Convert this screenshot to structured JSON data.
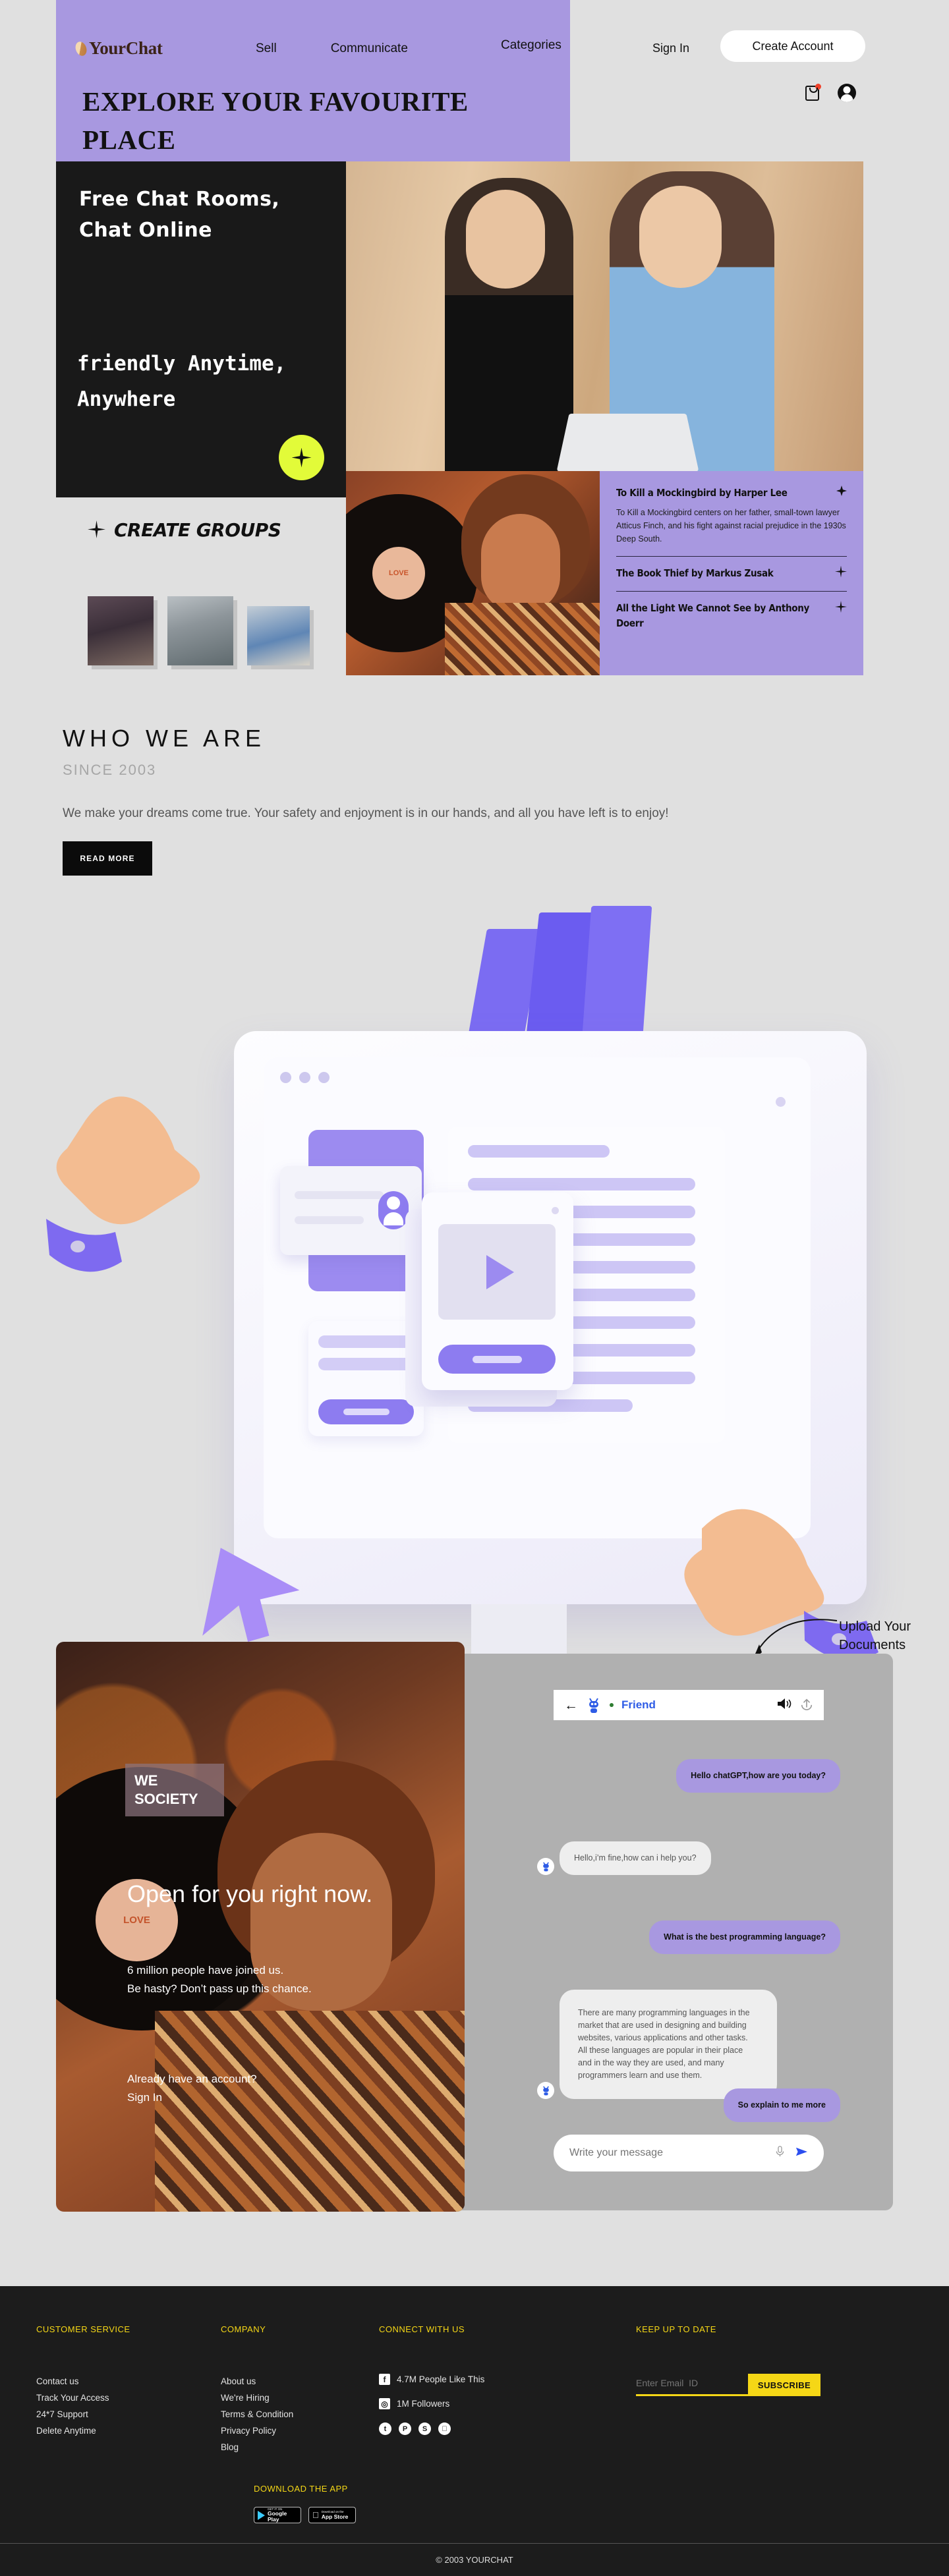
{
  "brand": {
    "name": "YourChat"
  },
  "nav": {
    "links": [
      "Sell",
      "Communicate",
      "Categories"
    ],
    "sign_in": "Sign In",
    "create_account": "Create Account",
    "icons": [
      "shopping-bag-icon",
      "user-avatar-icon"
    ]
  },
  "hero_banner": {
    "title": "EXPLORE YOUR FAVOURITE PLACE"
  },
  "hero": {
    "headline": "Free Chat Rooms, Chat Online",
    "subline": "friendly Anytime, Anywhere",
    "badge_icon": "four-point-star-icon"
  },
  "books": {
    "items": [
      {
        "title": "To Kill a Mockingbird by Harper Lee",
        "desc": "To Kill a Mockingbird centers on her father, small-town lawyer Atticus Finch, and his fight against racial prejudice in the 1930s Deep South.",
        "icon": "four-point-star-icon"
      },
      {
        "title": "The Book Thief by Markus Zusak",
        "desc": "",
        "icon": "four-point-star-icon"
      },
      {
        "title": "All the Light We Cannot See by Anthony Doerr",
        "desc": "",
        "icon": "four-point-star-icon"
      }
    ]
  },
  "groups": {
    "title": "CREATE GROUPS",
    "icon": "four-point-star-icon"
  },
  "who_we_are": {
    "title": "WHO WE ARE",
    "since": "SINCE 2003",
    "body": "We make your dreams come true. Your safety and enjoyment is in our hands, and all you have left is to enjoy!",
    "cta": "READ MORE"
  },
  "promo": {
    "tag": "WE SOCIETY",
    "headline": "Open for you right now.",
    "sub_line1": "6 million people have joined us.",
    "sub_line2": "Be hasty? Don’t pass up this chance.",
    "account_line1": "Already have an account?",
    "account_line2": "Sign In"
  },
  "chat": {
    "contact_name": "Friend",
    "back_icon": "arrow-left-icon",
    "bot_icon": "robot-avatar-icon",
    "status_icon": "online-status-dot",
    "speaker_icon": "speaker-icon",
    "upload_icon": "upload-icon",
    "annotation": "Upload Your Documents",
    "messages": [
      {
        "from": "user",
        "text": "Hello chatGPT,how are you today?"
      },
      {
        "from": "bot",
        "text": "Hello,i’m fine,how can i help you?"
      },
      {
        "from": "user",
        "text": "What is the best programming language?"
      },
      {
        "from": "bot",
        "text": "There are many programming languages in the market that are used in designing and building websites, various applications and other tasks. All these languages are popular in their place and in the way they are used, and many programmers learn and use them."
      },
      {
        "from": "user",
        "text": "So explain to me more"
      }
    ],
    "input_placeholder": "Write your message",
    "mic_icon": "microphone-icon",
    "send_icon": "send-icon"
  },
  "footer": {
    "columns": [
      {
        "heading": "CUSTOMER SERVICE",
        "links": [
          "Contact us",
          "Track Your Access",
          "24*7 Support",
          "Delete Anytime"
        ]
      },
      {
        "heading": "COMPANY",
        "links": [
          "About us",
          "We're Hiring",
          "Terms & Condition",
          "Privacy Policy",
          "Blog"
        ]
      }
    ],
    "connect": {
      "heading": "CONNECT WITH US",
      "stats": [
        {
          "icon": "facebook-icon",
          "glyph": "f",
          "label": "4.7M People Like This"
        },
        {
          "icon": "instagram-icon",
          "glyph": "◎",
          "label": "1M Followers"
        }
      ],
      "socials": [
        {
          "icon": "twitter-icon",
          "glyph": "🐦"
        },
        {
          "icon": "pinterest-icon",
          "glyph": "P"
        },
        {
          "icon": "snapchat-icon",
          "glyph": "👻"
        },
        {
          "icon": "apple-icon",
          "glyph": ""
        }
      ]
    },
    "newsletter": {
      "heading": "KEEP UP TO DATE",
      "placeholder": "Enter Email  ID",
      "button": "SUBSCRIBE"
    },
    "download": {
      "heading": "DOWNLOAD THE APP",
      "stores": [
        {
          "small": "GET IT ON",
          "big": "Google Play"
        },
        {
          "small": "Download on the",
          "big": "App Store"
        }
      ]
    },
    "copyright": "© 2003 YOURCHAT"
  },
  "colors": {
    "purple": "#a898e0",
    "dark": "#191919",
    "yellow_badge": "#e2fb39",
    "footer_yellow": "#f5d716",
    "bg": "#e0e0e0"
  }
}
